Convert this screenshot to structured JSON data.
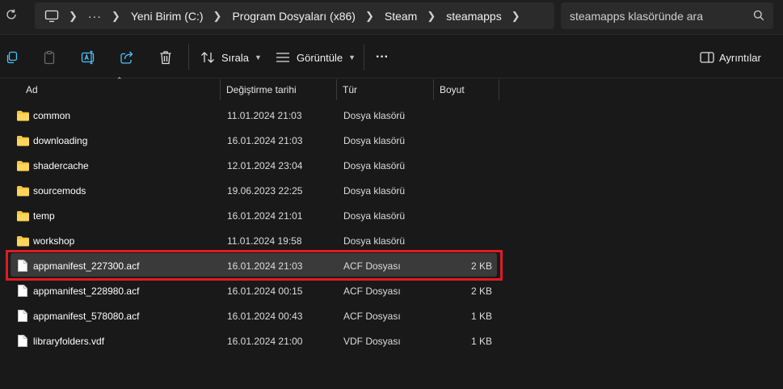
{
  "address": {
    "crumbs": [
      "Yeni Birim (C:)",
      "Program Dosyaları (x86)",
      "Steam",
      "steamapps"
    ],
    "search_placeholder": "steamapps klasöründe ara"
  },
  "toolbar": {
    "sort_label": "Sırala",
    "view_label": "Görüntüle",
    "more_label": "···",
    "details_label": "Ayrıntılar"
  },
  "columns": {
    "name": "Ad",
    "date": "Değiştirme tarihi",
    "type": "Tür",
    "size": "Boyut"
  },
  "files": [
    {
      "name": "common",
      "date": "11.01.2024 21:03",
      "type": "Dosya klasörü",
      "size": "",
      "kind": "folder"
    },
    {
      "name": "downloading",
      "date": "16.01.2024 21:03",
      "type": "Dosya klasörü",
      "size": "",
      "kind": "folder"
    },
    {
      "name": "shadercache",
      "date": "12.01.2024 23:04",
      "type": "Dosya klasörü",
      "size": "",
      "kind": "folder"
    },
    {
      "name": "sourcemods",
      "date": "19.06.2023 22:25",
      "type": "Dosya klasörü",
      "size": "",
      "kind": "folder"
    },
    {
      "name": "temp",
      "date": "16.01.2024 21:01",
      "type": "Dosya klasörü",
      "size": "",
      "kind": "folder"
    },
    {
      "name": "workshop",
      "date": "11.01.2024 19:58",
      "type": "Dosya klasörü",
      "size": "",
      "kind": "folder"
    },
    {
      "name": "appmanifest_227300.acf",
      "date": "16.01.2024 21:03",
      "type": "ACF Dosyası",
      "size": "2 KB",
      "kind": "file",
      "selected": true
    },
    {
      "name": "appmanifest_228980.acf",
      "date": "16.01.2024 00:15",
      "type": "ACF Dosyası",
      "size": "2 KB",
      "kind": "file"
    },
    {
      "name": "appmanifest_578080.acf",
      "date": "16.01.2024 00:43",
      "type": "ACF Dosyası",
      "size": "1 KB",
      "kind": "file"
    },
    {
      "name": "libraryfolders.vdf",
      "date": "16.01.2024 21:00",
      "type": "VDF Dosyası",
      "size": "1 KB",
      "kind": "file"
    }
  ],
  "colors": {
    "accent": "#4cc2ff",
    "folder": "#f8c640",
    "highlight": "#e11b22"
  }
}
